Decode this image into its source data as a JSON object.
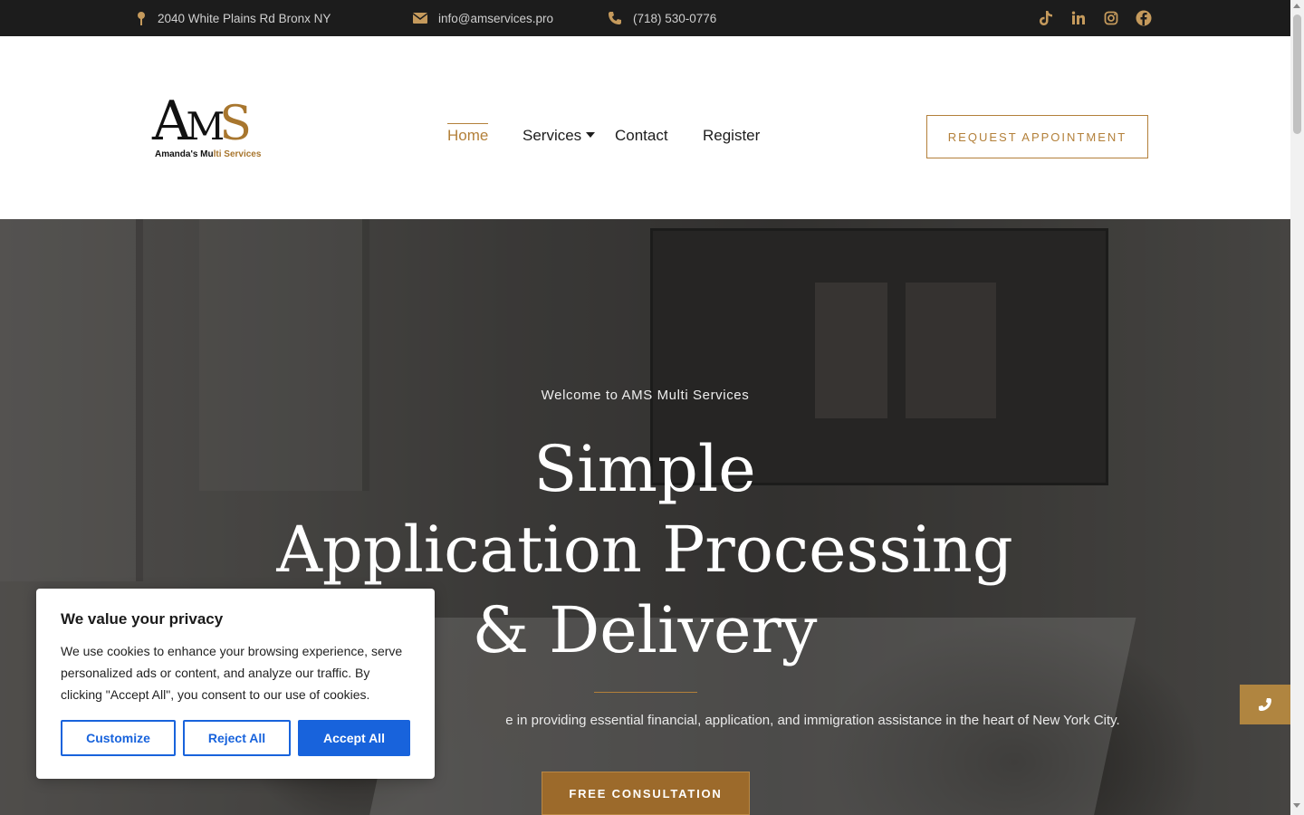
{
  "topbar": {
    "address": "2040 White Plains Rd Bronx NY",
    "email": "info@amservices.pro",
    "phone": "(718) 530-0776",
    "social": [
      "tiktok-icon",
      "linkedin-icon",
      "instagram-icon",
      "facebook-icon"
    ],
    "icon_color": "#c59a5c"
  },
  "logo": {
    "letters_a": "A",
    "letters_m": "M",
    "letters_s": "S",
    "subtitle_a": "Amanda's Mu",
    "subtitle_b": "lti Services"
  },
  "nav": {
    "home": "Home",
    "services": "Services",
    "contact": "Contact",
    "register": "Register",
    "cta": "REQUEST APPOINTMENT"
  },
  "hero": {
    "welcome": "Welcome to AMS Multi Services",
    "headline_1": "Simple",
    "headline_2": "Application Processing",
    "headline_3": "& Delivery",
    "tagline": "e in providing essential financial, application, and immigration assistance in the heart of New York City.",
    "cta": "FREE CONSULTATION"
  },
  "cookie": {
    "title": "We value your privacy",
    "text": "We use cookies to enhance your browsing experience, serve personalized ads or content, and analyze our traffic. By clicking \"Accept All\", you consent to our use of cookies.",
    "customize": "Customize",
    "reject": "Reject All",
    "accept": "Accept All"
  },
  "colors": {
    "gold": "#b3803a",
    "dark": "#1c1c1c",
    "cookie_blue": "#1863dc"
  }
}
